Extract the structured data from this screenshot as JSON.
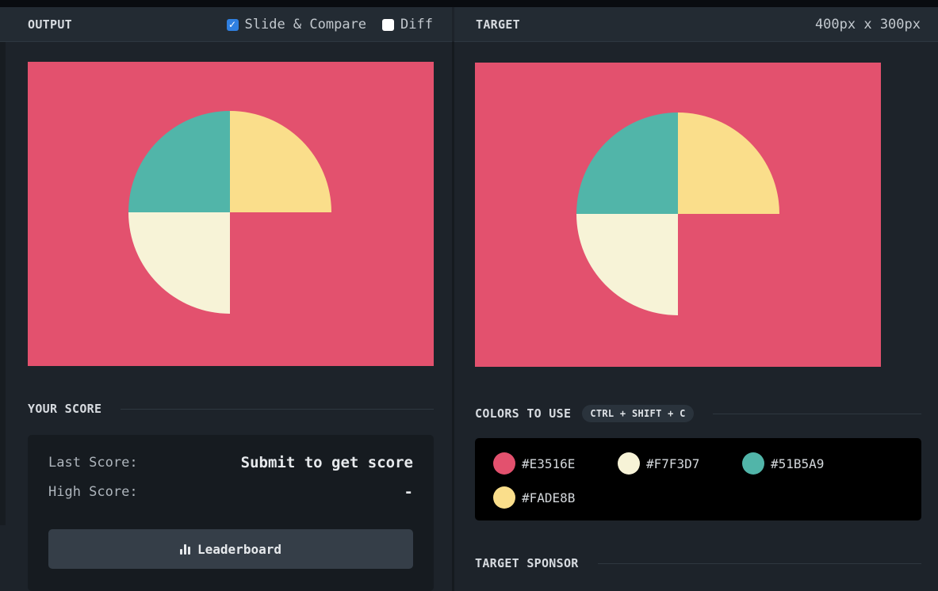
{
  "output_header": {
    "title": "OUTPUT",
    "slide_compare_label": "Slide & Compare",
    "slide_compare_checked": true,
    "diff_label": "Diff",
    "diff_checked": false
  },
  "target_header": {
    "title": "TARGET",
    "dimensions": "400px x 300px"
  },
  "canvas": {
    "background": "#E3516E",
    "quadrants": {
      "top_left": "#51B5A9",
      "top_right": "#FADE8B",
      "bottom_left": "#F7F3D7"
    }
  },
  "score": {
    "heading": "YOUR SCORE",
    "last_label": "Last Score:",
    "last_value": "Submit to get score",
    "high_label": "High Score:",
    "high_value": "-",
    "leaderboard_label": "Leaderboard",
    "leaderboard_icon": "bar-chart-icon"
  },
  "colors": {
    "heading": "COLORS TO USE",
    "shortcut": "CTRL + SHIFT + C",
    "items": [
      {
        "hex": "#E3516E"
      },
      {
        "hex": "#F7F3D7"
      },
      {
        "hex": "#51B5A9"
      },
      {
        "hex": "#FADE8B"
      }
    ]
  },
  "sponsor": {
    "heading": "TARGET SPONSOR"
  }
}
